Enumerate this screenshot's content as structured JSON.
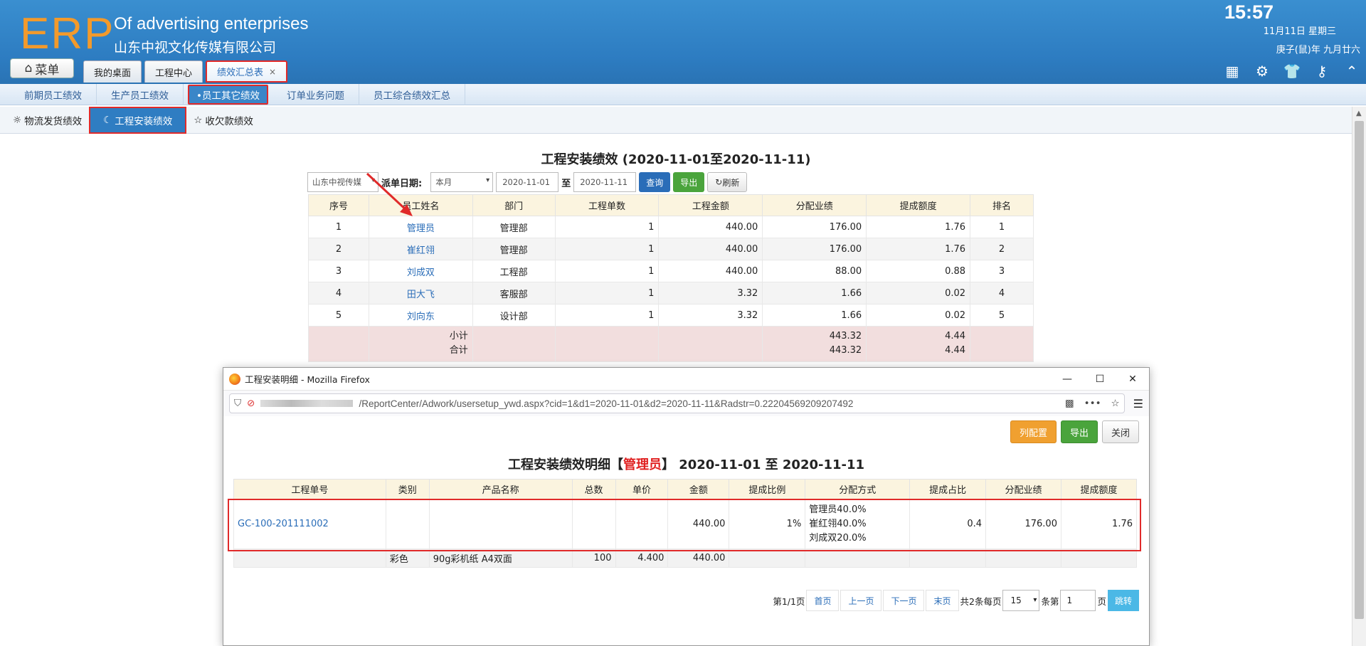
{
  "header": {
    "logo": "ERP",
    "brand_en": "Of advertising enterprises",
    "brand_cn": "山东中视文化传媒有限公司",
    "time": "15:57",
    "date_line1": "11月11日 星期三",
    "date_line2": "庚子(鼠)年 九月廿六",
    "menu_label": "菜单",
    "tabs": [
      {
        "label": "我的桌面"
      },
      {
        "label": "工程中心"
      },
      {
        "label": "绩效汇总表",
        "close": "×"
      }
    ]
  },
  "subnav": {
    "items": [
      "前期员工绩效",
      "生产员工绩效",
      "•员工其它绩效",
      "订单业务问题",
      "员工综合绩效汇总"
    ]
  },
  "subnav2": {
    "items": [
      "物流发货绩效",
      "工程安装绩效",
      "收欠款绩效"
    ]
  },
  "report": {
    "title": "工程安装绩效 (2020-11-01至2020-11-11)",
    "filters": {
      "company": "山东中视传媒",
      "date_label": "派单日期:",
      "period": "本月",
      "date_from": "2020-11-01",
      "to_label": "至",
      "date_to": "2020-11-11",
      "query": "查询",
      "export": "导出",
      "refresh": "刷新"
    },
    "columns": [
      "序号",
      "员工姓名",
      "部门",
      "工程单数",
      "工程金额",
      "分配业绩",
      "提成额度",
      "排名"
    ],
    "rows": [
      {
        "no": "1",
        "name": "管理员",
        "dept": "管理部",
        "count": "1",
        "amount": "440.00",
        "perf": "176.00",
        "commission": "1.76",
        "rank": "1"
      },
      {
        "no": "2",
        "name": "崔红翎",
        "dept": "管理部",
        "count": "1",
        "amount": "440.00",
        "perf": "176.00",
        "commission": "1.76",
        "rank": "2"
      },
      {
        "no": "3",
        "name": "刘成双",
        "dept": "工程部",
        "count": "1",
        "amount": "440.00",
        "perf": "88.00",
        "commission": "0.88",
        "rank": "3"
      },
      {
        "no": "4",
        "name": "田大飞",
        "dept": "客服部",
        "count": "1",
        "amount": "3.32",
        "perf": "1.66",
        "commission": "0.02",
        "rank": "4"
      },
      {
        "no": "5",
        "name": "刘向东",
        "dept": "设计部",
        "count": "1",
        "amount": "3.32",
        "perf": "1.66",
        "commission": "0.02",
        "rank": "5"
      }
    ],
    "subtotal_label": "小计",
    "total_label": "合计",
    "subtotal_perf": "443.32",
    "subtotal_commission": "4.44",
    "total_perf": "443.32",
    "total_commission": "4.44"
  },
  "popup": {
    "window_title": "工程安装明细 - Mozilla Firefox",
    "url": "/ReportCenter/Adwork/usersetup_ywd.aspx?cid=1&d1=2020-11-01&d2=2020-11-11&Radstr=0.22204569209207492",
    "buttons": {
      "columns": "列配置",
      "export": "导出",
      "close": "关闭"
    },
    "title_prefix": "工程安装绩效明细【",
    "title_name": "管理员",
    "title_suffix": "】 2020-11-01 至 2020-11-11",
    "columns": [
      "工程单号",
      "类别",
      "产品名称",
      "总数",
      "单价",
      "金额",
      "提成比例",
      "分配方式",
      "提成占比",
      "分配业绩",
      "提成额度"
    ],
    "row": {
      "order_no": "GC-100-201111002",
      "amount": "440.00",
      "rate": "1%",
      "alloc": [
        "管理员40.0%",
        "崔红翎40.0%",
        "刘成双20.0%"
      ],
      "ratio": "0.4",
      "perf": "176.00",
      "commission": "1.76"
    },
    "subrow": {
      "category": "彩色",
      "product": "90g彩机纸 A4双面",
      "qty": "100",
      "price": "4.400",
      "amount": "440.00"
    },
    "pager": {
      "page_info": "第1/1页",
      "first": "首页",
      "prev": "上一页",
      "next": "下一页",
      "last": "末页",
      "total_info": "共2条每页",
      "page_size": "15",
      "goto_label": "条第",
      "goto_value": "1",
      "page_suffix": "页",
      "jump": "跳转"
    }
  }
}
